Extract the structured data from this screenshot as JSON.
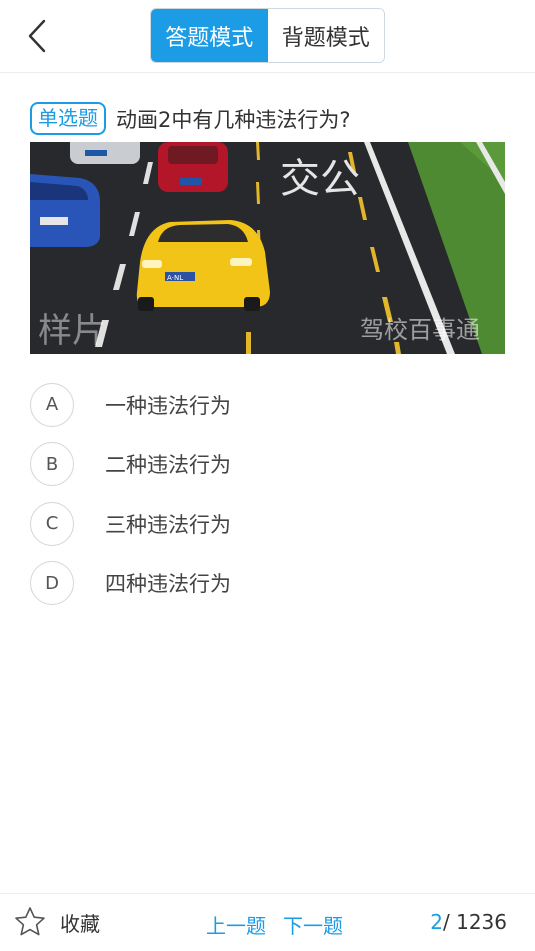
{
  "header": {
    "tabs": [
      {
        "label": "答题模式",
        "active": true
      },
      {
        "label": "背题模式",
        "active": false
      }
    ],
    "back_icon": "chevron-left-icon"
  },
  "question": {
    "type_badge": "单选题",
    "text": "动画2中有几种违法行为?"
  },
  "media": {
    "road_text": "交公",
    "watermark_left": "样片",
    "watermark_right": "驾校百事通",
    "plate_text": "A·NL"
  },
  "options": [
    {
      "letter": "A",
      "text": "一种违法行为"
    },
    {
      "letter": "B",
      "text": "二种违法行为"
    },
    {
      "letter": "C",
      "text": "三种违法行为"
    },
    {
      "letter": "D",
      "text": "四种违法行为"
    }
  ],
  "footer": {
    "favorite_label": "收藏",
    "prev_label": "上一题",
    "next_label": "下一题",
    "current": "2",
    "separator": "/",
    "total": "1236"
  },
  "colors": {
    "accent": "#1c9ce5",
    "road": "#26282b",
    "grass": "#4e8a32",
    "taxi": "#f3c418"
  }
}
